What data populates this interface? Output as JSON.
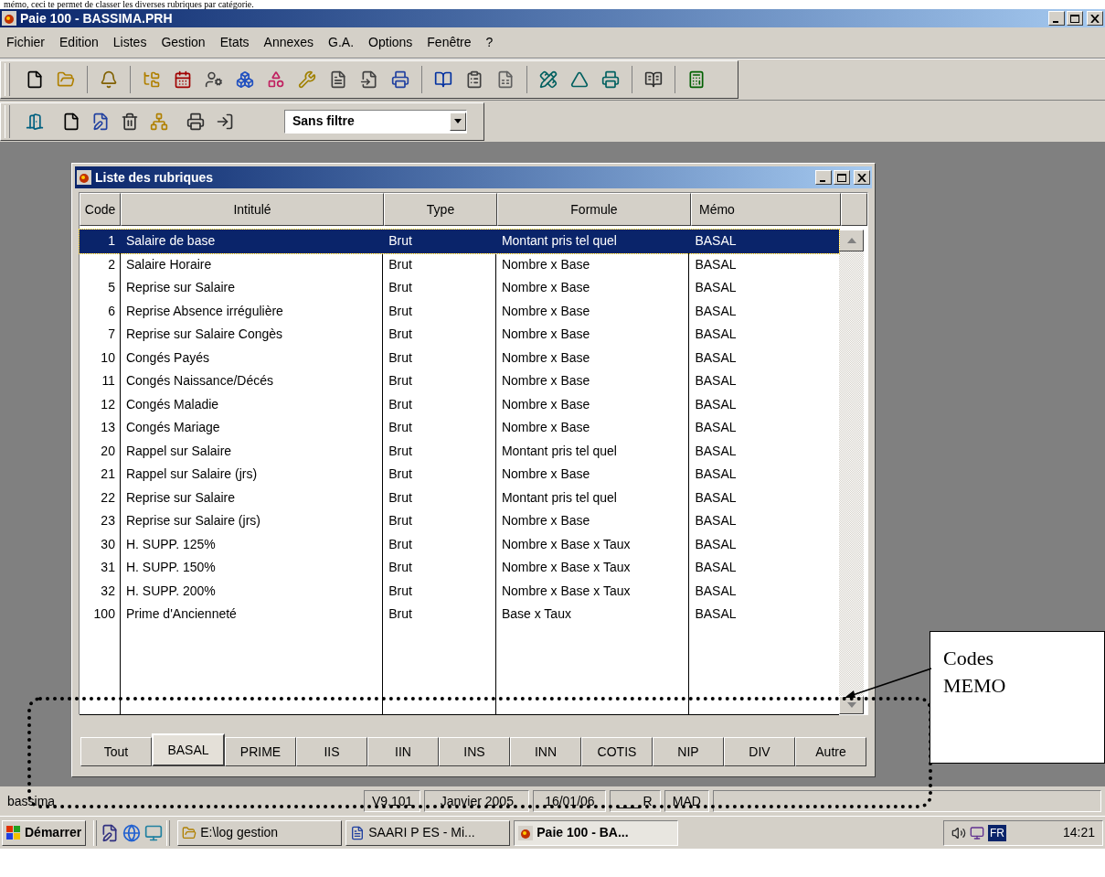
{
  "document_text": "mémo, ceci te permet de classer les diverses rubriques par catégorie.",
  "app": {
    "title": "Paie 100 - BASSIMA.PRH",
    "menu": [
      "Fichier",
      "Edition",
      "Listes",
      "Gestion",
      "Etats",
      "Annexes",
      "G.A.",
      "Options",
      "Fenêtre",
      "?"
    ],
    "filter": {
      "value": "Sans filtre"
    }
  },
  "list_window": {
    "title": "Liste des rubriques",
    "columns": [
      "Code",
      "Intitulé",
      "Type",
      "Formule",
      "Mémo"
    ],
    "rows": [
      {
        "code": "1",
        "label": "Salaire de base",
        "type": "Brut",
        "formula": "Montant pris tel quel",
        "memo": "BASAL",
        "selected": true
      },
      {
        "code": "2",
        "label": "Salaire Horaire",
        "type": "Brut",
        "formula": "Nombre x Base",
        "memo": "BASAL",
        "selected": false
      },
      {
        "code": "5",
        "label": "Reprise sur Salaire",
        "type": "Brut",
        "formula": "Nombre x Base",
        "memo": "BASAL",
        "selected": false
      },
      {
        "code": "6",
        "label": "Reprise Absence irrégulière",
        "type": "Brut",
        "formula": "Nombre x Base",
        "memo": "BASAL",
        "selected": false
      },
      {
        "code": "7",
        "label": "Reprise sur Salaire Congès",
        "type": "Brut",
        "formula": "Nombre x Base",
        "memo": "BASAL",
        "selected": false
      },
      {
        "code": "10",
        "label": "Congés Payés",
        "type": "Brut",
        "formula": "Nombre x Base",
        "memo": "BASAL",
        "selected": false
      },
      {
        "code": "11",
        "label": "Congés Naissance/Décés",
        "type": "Brut",
        "formula": "Nombre x Base",
        "memo": "BASAL",
        "selected": false
      },
      {
        "code": "12",
        "label": "Congés Maladie",
        "type": "Brut",
        "formula": "Nombre x Base",
        "memo": "BASAL",
        "selected": false
      },
      {
        "code": "13",
        "label": "Congés Mariage",
        "type": "Brut",
        "formula": "Nombre x Base",
        "memo": "BASAL",
        "selected": false
      },
      {
        "code": "20",
        "label": "Rappel sur Salaire",
        "type": "Brut",
        "formula": "Montant pris tel quel",
        "memo": "BASAL",
        "selected": false
      },
      {
        "code": "21",
        "label": "Rappel sur Salaire (jrs)",
        "type": "Brut",
        "formula": "Nombre x Base",
        "memo": "BASAL",
        "selected": false
      },
      {
        "code": "22",
        "label": "Reprise sur Salaire",
        "type": "Brut",
        "formula": "Montant pris tel quel",
        "memo": "BASAL",
        "selected": false
      },
      {
        "code": "23",
        "label": "Reprise sur Salaire (jrs)",
        "type": "Brut",
        "formula": "Nombre x Base",
        "memo": "BASAL",
        "selected": false
      },
      {
        "code": "30",
        "label": "H. SUPP. 125%",
        "type": "Brut",
        "formula": "Nombre x Base x Taux",
        "memo": "BASAL",
        "selected": false
      },
      {
        "code": "31",
        "label": "H. SUPP. 150%",
        "type": "Brut",
        "formula": "Nombre x Base x Taux",
        "memo": "BASAL",
        "selected": false
      },
      {
        "code": "32",
        "label": "H. SUPP. 200%",
        "type": "Brut",
        "formula": "Nombre x Base x Taux",
        "memo": "BASAL",
        "selected": false
      },
      {
        "code": "100",
        "label": "Prime d'Ancienneté",
        "type": "Brut",
        "formula": "Base x Taux",
        "memo": "BASAL",
        "selected": false
      }
    ],
    "tabs": [
      {
        "label": "Tout",
        "selected": false
      },
      {
        "label": "BASAL",
        "selected": true
      },
      {
        "label": "PRIME",
        "selected": false
      },
      {
        "label": "IIS",
        "selected": false
      },
      {
        "label": "IIN",
        "selected": false
      },
      {
        "label": "INS",
        "selected": false
      },
      {
        "label": "INN",
        "selected": false
      },
      {
        "label": "COTIS",
        "selected": false
      },
      {
        "label": "NIP",
        "selected": false
      },
      {
        "label": "DIV",
        "selected": false
      },
      {
        "label": "Autre",
        "selected": false
      }
    ]
  },
  "status_bar": [
    "bassima",
    "V9.101",
    "Janvier 2005",
    "16/01/06",
    "___ R",
    "MAD"
  ],
  "taskbar": {
    "start": "Démarrer",
    "tasks": [
      {
        "label": "E:\\log gestion",
        "selected": false
      },
      {
        "label": "SAARI P ES - Mi...",
        "selected": false
      },
      {
        "label": "Paie 100 - BA...",
        "selected": true
      }
    ],
    "language": "FR",
    "time": "14:21"
  },
  "annotation": {
    "text": "Codes MEMO"
  }
}
